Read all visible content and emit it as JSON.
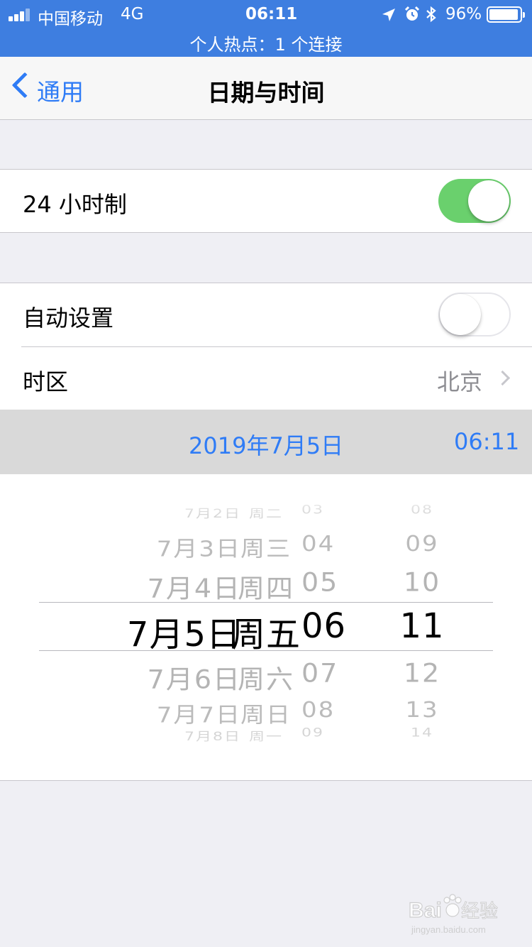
{
  "status_bar": {
    "carrier": "中国移动",
    "network": "4G",
    "time": "06:11",
    "battery": "96%",
    "battery_level": 0.96,
    "hotspot": "个人热点：1 个连接",
    "background_color": "#3e7ee0",
    "icons": [
      "signal-icon",
      "location-icon",
      "alarm-icon",
      "bluetooth-icon",
      "battery-icon"
    ]
  },
  "nav": {
    "back_label": "通用",
    "title": "日期与时间",
    "accent_color": "#2f7cf6"
  },
  "settings": {
    "hour24": {
      "label": "24 小时制",
      "on": true
    },
    "auto_set": {
      "label": "自动设置",
      "on": false
    },
    "timezone": {
      "label": "时区",
      "value": "北京"
    }
  },
  "selected": {
    "date": "2019年7月5日",
    "time": "06:11"
  },
  "picker": {
    "rows": [
      {
        "day": "7月2日",
        "weekday": "周二",
        "hour": "03",
        "minute": "08"
      },
      {
        "day": "7月3日",
        "weekday": "周三",
        "hour": "04",
        "minute": "09"
      },
      {
        "day": "7月4日",
        "weekday": "周四",
        "hour": "05",
        "minute": "10"
      },
      {
        "day": "7月5日",
        "weekday": "周五",
        "hour": "06",
        "minute": "11"
      },
      {
        "day": "7月6日",
        "weekday": "周六",
        "hour": "07",
        "minute": "12"
      },
      {
        "day": "7月7日",
        "weekday": "周日",
        "hour": "08",
        "minute": "13"
      },
      {
        "day": "7月8日",
        "weekday": "周一",
        "hour": "09",
        "minute": "14"
      }
    ]
  },
  "watermark": {
    "brand": "Baidu经验",
    "url": "jingyan.baidu.com"
  }
}
